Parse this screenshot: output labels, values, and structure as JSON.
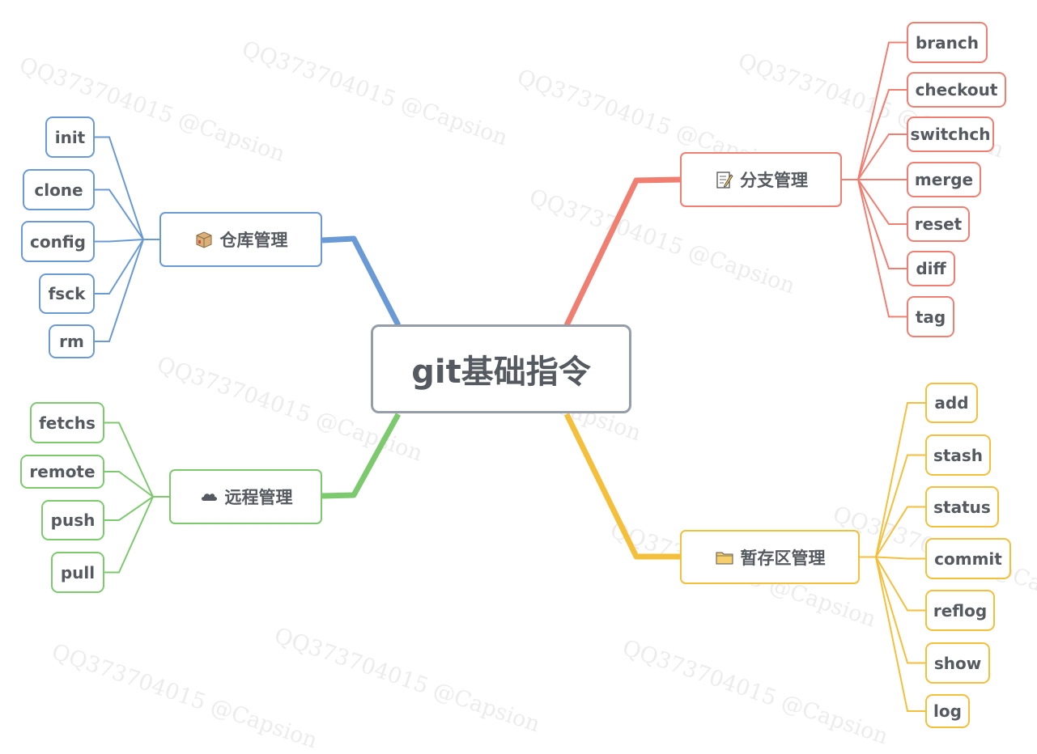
{
  "root": {
    "label": "git基础指令"
  },
  "watermark": "QQ373704015 @Capsion",
  "colors": {
    "repo": "#6a9ad6",
    "branch": "#f07f72",
    "remote": "#7cc96e",
    "stage": "#f4bf3a",
    "root_border": "#959ea8",
    "text": "#555a60"
  },
  "branches": {
    "repo": {
      "label": "仓库管理",
      "icon": "package-icon",
      "items": [
        "init",
        "clone",
        "config",
        "fsck",
        "rm"
      ]
    },
    "branch": {
      "label": "分支管理",
      "icon": "memo-icon",
      "items": [
        "branch",
        "checkout",
        "switchch",
        "merge",
        "reset",
        "diff",
        "tag"
      ]
    },
    "remote": {
      "label": "远程管理",
      "icon": "cloud-icon",
      "items": [
        "fetchs",
        "remote",
        "push",
        "pull"
      ]
    },
    "stage": {
      "label": "暂存区管理",
      "icon": "folder-icon",
      "items": [
        "add",
        "stash",
        "status",
        "commit",
        "reflog",
        "show",
        "log"
      ]
    }
  }
}
